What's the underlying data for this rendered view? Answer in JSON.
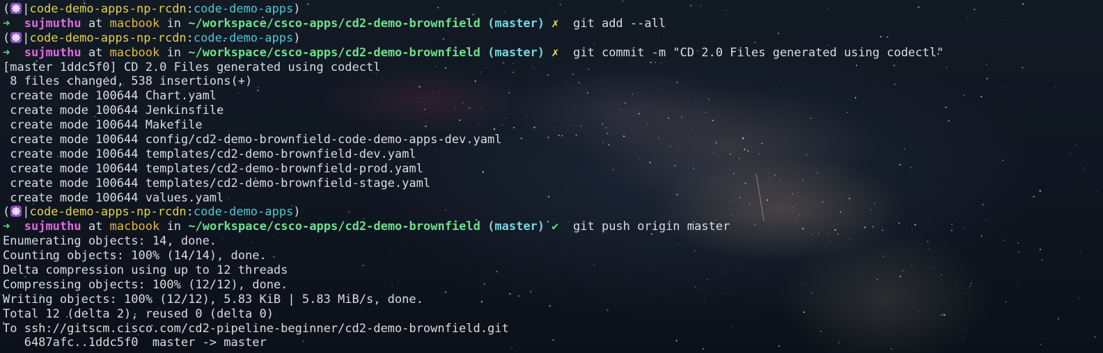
{
  "prompt": {
    "open_paren": "(",
    "separator": "|",
    "cluster": "code-demo-apps-np-rcdn",
    "colon": ":",
    "namespace": "code-demo-apps",
    "close_paren": ")",
    "arrow": "➜",
    "user": "sujmuthu",
    "at": "at",
    "host": "macbook",
    "in": "in",
    "path": "~/workspace/csco-apps/cd2-demo-brownfield",
    "branch": "(master)",
    "dirty_mark": "✗",
    "clean_mark": "✔"
  },
  "commands": {
    "add": "git add --all",
    "commit": "git commit -m \"CD 2.0 Files generated using codectl\"",
    "push": "git push origin master"
  },
  "commit_output": [
    "[master 1ddc5f0] CD 2.0 Files generated using codectl",
    " 8 files changed, 538 insertions(+)",
    " create mode 100644 Chart.yaml",
    " create mode 100644 Jenkinsfile",
    " create mode 100644 Makefile",
    " create mode 100644 config/cd2-demo-brownfield-code-demo-apps-dev.yaml",
    " create mode 100644 templates/cd2-demo-brownfield-dev.yaml",
    " create mode 100644 templates/cd2-demo-brownfield-prod.yaml",
    " create mode 100644 templates/cd2-demo-brownfield-stage.yaml",
    " create mode 100644 values.yaml"
  ],
  "push_output": [
    "Enumerating objects: 14, done.",
    "Counting objects: 100% (14/14), done.",
    "Delta compression using up to 12 threads",
    "Compressing objects: 100% (12/12), done.",
    "Writing objects: 100% (12/12), 5.83 KiB | 5.83 MiB/s, done.",
    "Total 12 (delta 2), reused 0 (delta 0)",
    "To ssh://gitscm.cisco.com/cd2-pipeline-beginner/cd2-demo-brownfield.git",
    "   6487afc..1ddc5f0  master -> master"
  ],
  "colors": {
    "cluster": "#e5d34a",
    "namespace": "#4fc8cf",
    "arrow": "#5ce07f",
    "user": "#e06adf",
    "host": "#e7b93e",
    "path": "#6ee08c",
    "branch": "#74d9e4",
    "kube_icon": "#8e4fc5"
  },
  "icons": {
    "kube": "kubernetes-helm-wheel-icon"
  }
}
